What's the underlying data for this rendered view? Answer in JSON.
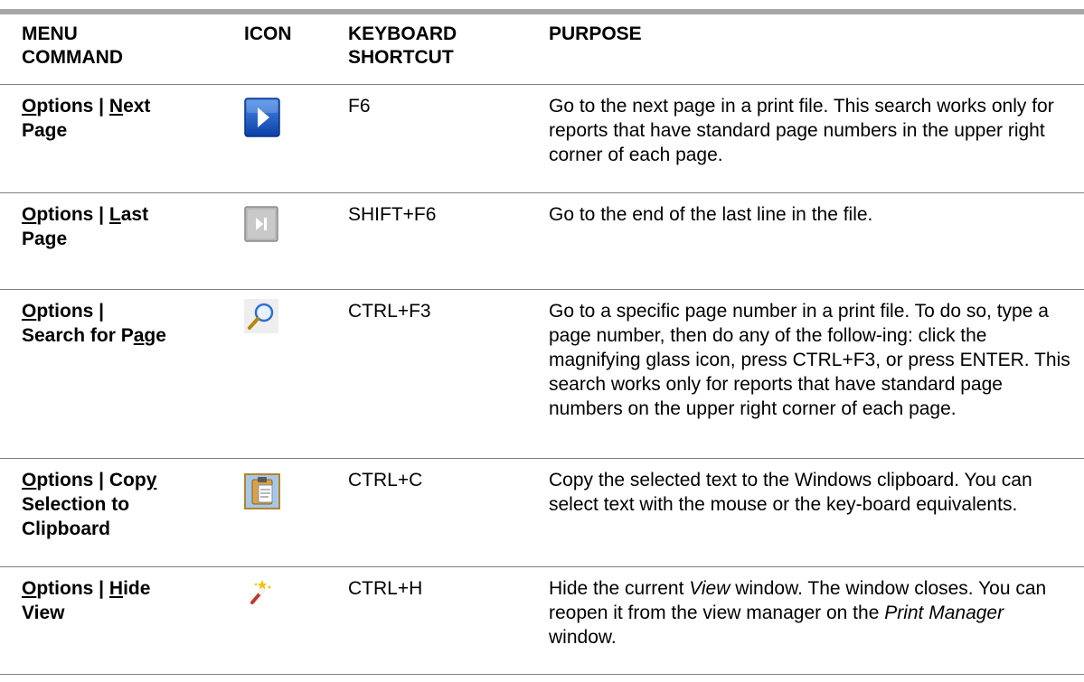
{
  "headers": {
    "menu_command_1": "MENU",
    "menu_command_2": "COMMAND",
    "icon": "ICON",
    "shortcut_1": "KEYBOARD",
    "shortcut_2": "SHORTCUT",
    "purpose": "PURPOSE"
  },
  "rows": [
    {
      "cmd_parts": [
        "O",
        "ptions | ",
        "N",
        "ext"
      ],
      "cmd_line2": "Page",
      "icon": "next-page-icon",
      "shortcut": "F6",
      "purpose": "Go to the next page in a print file. This search works only for reports that have standard page numbers in the upper right corner of each page."
    },
    {
      "cmd_parts": [
        "O",
        "ptions | ",
        "L",
        "ast"
      ],
      "cmd_line2": "Page",
      "icon": "last-page-icon",
      "shortcut": "SHIFT+F6",
      "purpose": "Go to the end of the last line in the file."
    },
    {
      "cmd_line1": "Options |",
      "cmd_line1_u": "O",
      "cmd_line1_rest": "ptions |",
      "cmd_line2_parts": [
        "Search for P",
        "a",
        "ge"
      ],
      "icon": "magnifying-glass-icon",
      "shortcut": "CTRL+F3",
      "purpose": "Go to a specific page number in a print file. To do so, type a page number, then do any of the follow-ing: click the magnifying glass icon, press CTRL+F3, or press ENTER. This search works only for reports that have standard page numbers on the upper right corner of each page."
    },
    {
      "cmd_parts": [
        "O",
        "ptions | Cop",
        "y",
        ""
      ],
      "cmd_line2": "Selection to",
      "cmd_line3": "Clipboard",
      "icon": "clipboard-icon",
      "shortcut": "CTRL+C",
      "purpose": "Copy the selected text to the Windows clipboard. You can select text with the mouse or the key-board equivalents."
    },
    {
      "cmd_parts": [
        "O",
        "ptions | ",
        "H",
        "ide"
      ],
      "cmd_line2": "View",
      "icon": "magic-wand-icon",
      "shortcut": "CTRL+H",
      "purpose_parts": [
        "Hide the current ",
        "View",
        " window. The window closes. You can reopen it from the view manager on the ",
        "Print Manager",
        " window."
      ]
    }
  ]
}
